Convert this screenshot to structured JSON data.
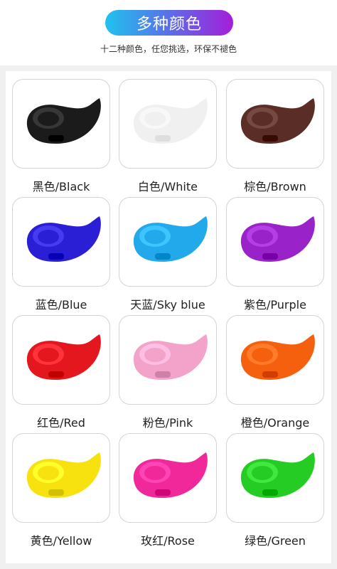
{
  "header": {
    "title": "多种颜色",
    "subtitle": "十二种颜色，任您挑选，环保不褪色"
  },
  "colors": [
    {
      "label": "黑色/Black",
      "hex": "#1b1b1b"
    },
    {
      "label": "白色/White",
      "hex": "#f0f0f0"
    },
    {
      "label": "棕色/Brown",
      "hex": "#5a2e26"
    },
    {
      "label": "蓝色/Blue",
      "hex": "#2b1fd6"
    },
    {
      "label": "天蓝/Sky blue",
      "hex": "#22a9ec"
    },
    {
      "label": "紫色/Purple",
      "hex": "#9a22c9"
    },
    {
      "label": "红色/Red",
      "hex": "#e4171f"
    },
    {
      "label": "粉色/Pink",
      "hex": "#f3a3c9"
    },
    {
      "label": "橙色/Orange",
      "hex": "#f5600f"
    },
    {
      "label": "黄色/Yellow",
      "hex": "#f7e20f"
    },
    {
      "label": "玫红/Rose",
      "hex": "#f0289a"
    },
    {
      "label": "绿色/Green",
      "hex": "#24cc23"
    }
  ]
}
